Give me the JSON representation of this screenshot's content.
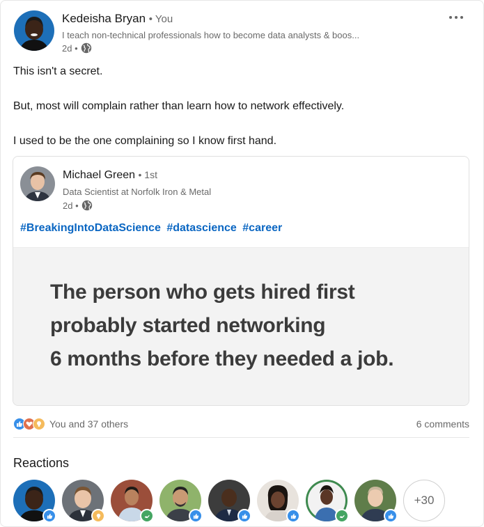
{
  "author": {
    "name": "Kedeisha Bryan",
    "you_label": "• You",
    "headline": "I teach non-technical professionals how to become data analysts & boos...",
    "time": "2d •",
    "avatar_icon": "person-avatar"
  },
  "post": {
    "lines": [
      "This isn't a secret.",
      "But, most will complain rather than learn how to network effectively.",
      "I used to be the one complaining so I know first hand."
    ]
  },
  "shared_post": {
    "name": "Michael Green",
    "degree": "• 1st",
    "headline": "Data Scientist at Norfolk Iron & Metal",
    "time": "2d •",
    "hashtags": [
      "#BreakingIntoDataScience",
      "#datascience",
      "#career"
    ],
    "image_text": [
      "The person who gets hired first",
      "probably started networking",
      "6 months before they needed a job."
    ]
  },
  "social": {
    "reaction_icons": [
      "like-icon",
      "love-icon",
      "insightful-icon"
    ],
    "reactions_text": "You and 37 others",
    "comments_text": "6 comments"
  },
  "reactions": {
    "title": "Reactions",
    "more_label": "+30"
  },
  "colors": {
    "link_blue": "#0a66c2",
    "like_blue": "#378fe9",
    "love_orange": "#df704d",
    "insight_yellow": "#f5bb5c",
    "support_green": "#44a562"
  }
}
